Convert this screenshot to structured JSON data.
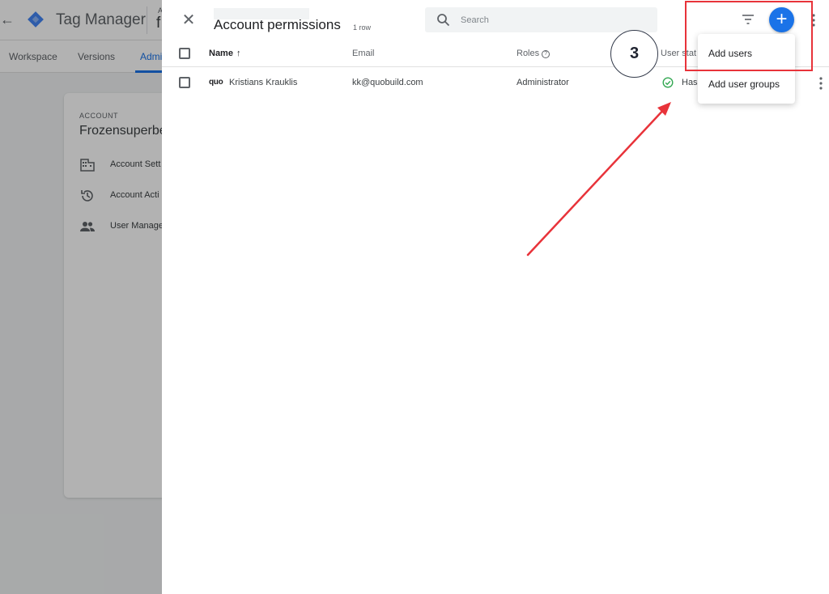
{
  "background": {
    "product_name": "Tag Manager",
    "breadcrumb_small": "A",
    "breadcrumb_big": "f",
    "nav": [
      "Workspace",
      "Versions",
      "Admi"
    ],
    "account_label": "ACCOUNT",
    "account_name": "Frozensuperbe",
    "menu_items": [
      {
        "label": "Account Sett",
        "icon": "building-icon"
      },
      {
        "label": "Account Acti",
        "icon": "history-icon"
      },
      {
        "label": "User Manage",
        "icon": "people-icon"
      }
    ]
  },
  "panel": {
    "title": "Account permissions",
    "row_count": "1 row",
    "search": {
      "placeholder": "Search"
    },
    "columns": {
      "name": "Name",
      "email": "Email",
      "roles": "Roles",
      "status": "User stat"
    },
    "rows": [
      {
        "avatar_text": "quo",
        "name": "Kristians Krauklis",
        "email": "kk@quobuild.com",
        "role": "Administrator",
        "status": "Has"
      }
    ],
    "menu": {
      "items": [
        "Add users",
        "Add user groups"
      ]
    }
  },
  "annotation": {
    "step_number": "3",
    "accent_color": "#e8333a"
  },
  "colors": {
    "primary": "#1a73e8",
    "status_ok": "#34a853"
  }
}
